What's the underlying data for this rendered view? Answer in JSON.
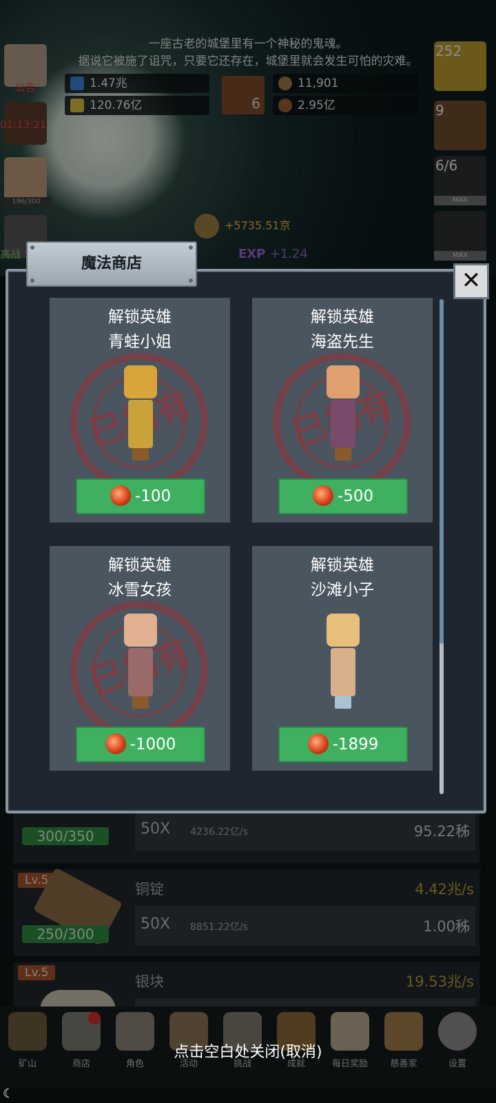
{
  "story": {
    "line1": "一座古老的城堡里有一个神秘的鬼魂。",
    "line2": "据说它被施了诅咒，只要它还存在，城堡里就会发生可怕的灾难。"
  },
  "resources": {
    "blue_potion": "1.47兆",
    "yellow_potion": "120.76亿",
    "book_count": "6",
    "coin": "11,901",
    "meat": "2.95亿"
  },
  "left_panel": {
    "announcement": "公告",
    "timer": "01:13:21",
    "progress": "196/300",
    "challenge": "高战"
  },
  "right_panel": {
    "potion_count": "252",
    "chest_count": "9",
    "slime_count": "6/6",
    "max_label": "MAX"
  },
  "popups": {
    "coin_gain": "+5735.51京",
    "exp_label": "EXP",
    "exp_gain": "+1.24"
  },
  "shop": {
    "title": "魔法商店",
    "close": "✕",
    "stamp_text": "已拥有",
    "cards": [
      {
        "action": "解锁英雄",
        "name": "青蛙小姐",
        "price": "-100",
        "head": "#d9a43a",
        "body": "#caa23c"
      },
      {
        "action": "解锁英雄",
        "name": "海盗先生",
        "price": "-500",
        "head": "#e0a070",
        "body": "#7a4a6a"
      },
      {
        "action": "解锁英雄",
        "name": "冰雪女孩",
        "price": "-1000",
        "head": "#e0b090",
        "body": "#9a6a6a"
      },
      {
        "action": "解锁英雄",
        "name": "沙滩小子",
        "price": "-1899",
        "head": "#e6c07a",
        "body": "#d8b08a"
      }
    ]
  },
  "mines": [
    {
      "level": "",
      "name": "",
      "rate": "",
      "capacity": "300/350",
      "mult": "50X",
      "speed": "4236.22亿/s",
      "cost": "95.22秭"
    },
    {
      "level": "Lv.5",
      "name": "铜锭",
      "rate": "4.42兆/s",
      "capacity": "250/300",
      "mult": "50X",
      "speed": "8851.22亿/s",
      "cost": "1.00秭"
    },
    {
      "level": "Lv.5",
      "name": "银块",
      "rate": "19.53兆/s",
      "capacity": "",
      "mult": "",
      "speed": "",
      "cost": ""
    }
  ],
  "tabs": [
    {
      "label": "矿山",
      "icon": "lantern-icon"
    },
    {
      "label": "商店",
      "icon": "shop-icon"
    },
    {
      "label": "角色",
      "icon": "skull-icon"
    },
    {
      "label": "活动",
      "icon": "scroll-icon"
    },
    {
      "label": "挑战",
      "icon": "map-icon"
    },
    {
      "label": "成就",
      "icon": "key-icon"
    },
    {
      "label": "每日奖励",
      "icon": "envelope-icon"
    },
    {
      "label": "慈善家",
      "icon": "bread-icon"
    },
    {
      "label": "设置",
      "icon": "gear-icon"
    }
  ],
  "hint": "点击空白处关闭(取消)",
  "colors": {
    "buy_button": "#3eb05f",
    "modal_bg": "#1f2631",
    "card_bg": "#4a5560"
  }
}
